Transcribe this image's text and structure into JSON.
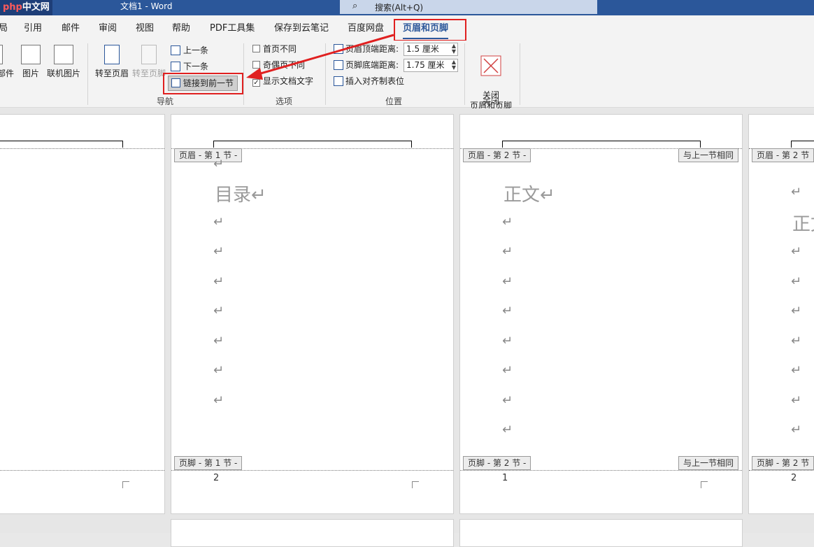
{
  "titlebar": {
    "logo_left": "php",
    "logo_right": "中文网",
    "title": "文档1  -  Word",
    "search_placeholder": "搜索(Alt+Q)"
  },
  "tabs": [
    "局",
    "引用",
    "邮件",
    "审阅",
    "视图",
    "帮助",
    "PDF工具集",
    "保存到云笔记",
    "百度网盘",
    "页眉和页脚"
  ],
  "ribbon": {
    "insert": {
      "partial_label": "部件",
      "picture": "图片",
      "online_picture": "联机图片"
    },
    "nav": {
      "goto_header": "转至页眉",
      "goto_footer": "转至页脚",
      "prev": "上一条",
      "next": "下一条",
      "link_prev": "链接到前一节",
      "label": "导航"
    },
    "options": {
      "first_page": "首页不同",
      "odd_even": "奇偶页不同",
      "show_text": "显示文档文字",
      "label": "选项"
    },
    "position": {
      "header_top": "页眉顶端距离:",
      "header_top_val": "1.5 厘米",
      "footer_bottom": "页脚底端距离:",
      "footer_bottom_val": "1.75 厘米",
      "insert_tab": "插入对齐制表位",
      "label": "位置"
    },
    "close": {
      "btn": "关闭\n页眉和页脚",
      "label": "关闭"
    }
  },
  "pages": {
    "p2": {
      "header_tag": "页眉 - 第 1 节 -",
      "footer_tag": "页脚 - 第 1 节 -",
      "heading": "目录↵",
      "page_num": "2"
    },
    "p3": {
      "header_tag": "页眉 - 第 2 节 -",
      "footer_tag": "页脚 - 第 2 节 -",
      "same_as_prev": "与上一节相同",
      "heading": "正文↵",
      "page_num": "1"
    },
    "p4": {
      "header_tag": "页眉 - 第 2 节",
      "footer_tag": "页脚 - 第 2 节",
      "heading": "正文",
      "page_num": "2"
    },
    "return_mark": "↵"
  },
  "colors": {
    "brand": "#2b579a",
    "highlight": "#e02020"
  }
}
